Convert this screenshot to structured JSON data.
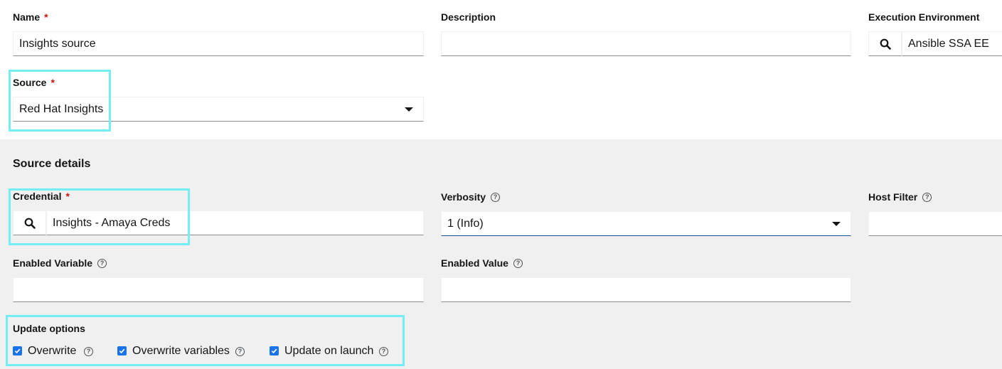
{
  "form": {
    "name": {
      "label": "Name",
      "required": "*",
      "value": "Insights source"
    },
    "description": {
      "label": "Description",
      "value": ""
    },
    "execution_environment": {
      "label": "Execution Environment",
      "value": "Ansible SSA EE"
    },
    "source": {
      "label": "Source",
      "required": "*",
      "value": "Red Hat Insights"
    }
  },
  "source_details": {
    "heading": "Source details",
    "credential": {
      "label": "Credential",
      "required": "*",
      "value": "Insights - Amaya Creds"
    },
    "verbosity": {
      "label": "Verbosity",
      "value": "1 (Info)"
    },
    "host_filter": {
      "label": "Host Filter",
      "value": ""
    },
    "enabled_variable": {
      "label": "Enabled Variable",
      "value": ""
    },
    "enabled_value": {
      "label": "Enabled Value",
      "value": ""
    },
    "update_options": {
      "label": "Update options",
      "items": [
        {
          "label": "Overwrite",
          "checked": true
        },
        {
          "label": "Overwrite variables",
          "checked": true
        },
        {
          "label": "Update on launch",
          "checked": true
        }
      ]
    }
  },
  "icons": {
    "help": "?",
    "search": "search-icon",
    "dropdown": "caret-down-icon"
  },
  "colors": {
    "highlight": "#73eef4",
    "required": "#c9190b",
    "checkbox": "#1a73e8",
    "section_bg": "#f0f0f0"
  }
}
